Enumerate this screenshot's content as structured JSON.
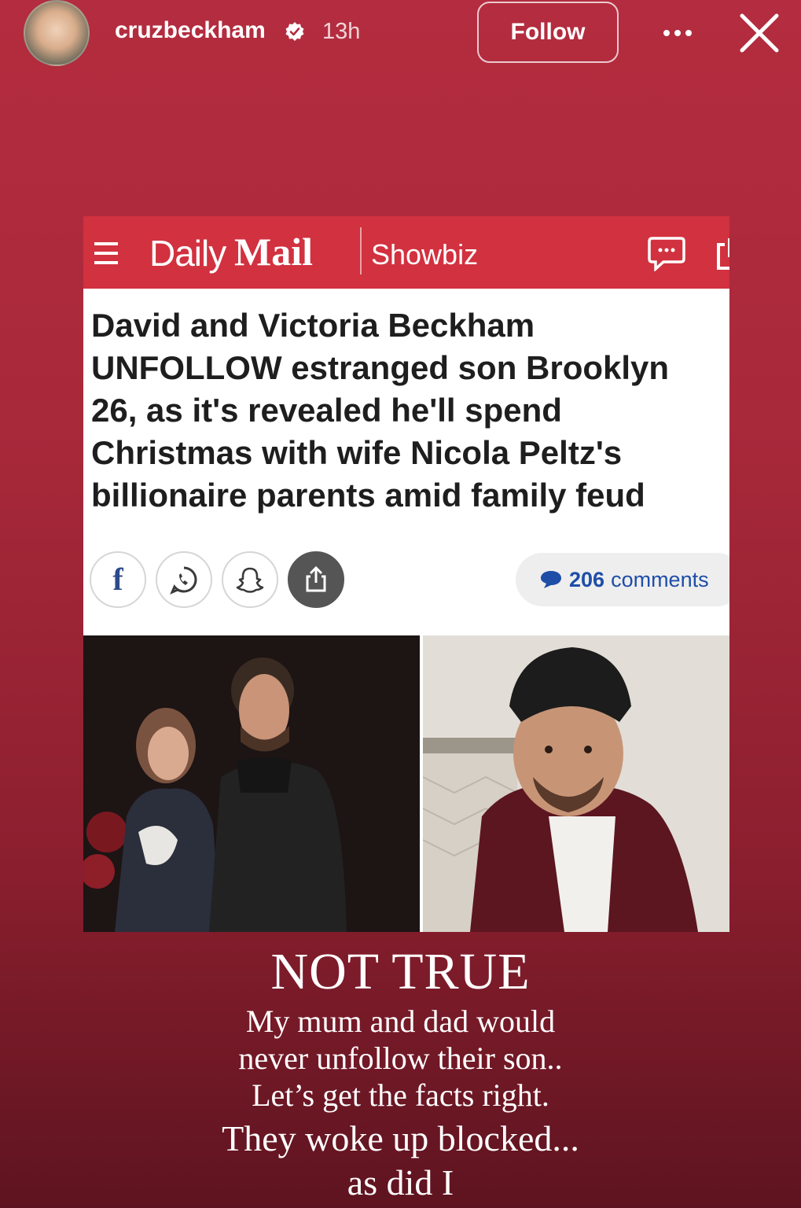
{
  "story": {
    "username": "cruzbeckham",
    "time_ago": "13h",
    "follow_label": "Follow",
    "more_icon": "more-dots-icon",
    "close_icon": "close-icon"
  },
  "article": {
    "brand_daily": "Daily",
    "brand_mail": "Mail",
    "section": "Showbiz",
    "headline_lines": [
      "David and Victoria Beckham",
      "UNFOLLOW estranged son Brooklyn",
      "26, as it's revealed he'll spend",
      "Christmas with wife Nicola Peltz's",
      "billionaire parents amid family feud"
    ],
    "comments_count": "206",
    "comments_word": "comments",
    "share_icons": [
      "facebook-icon",
      "whatsapp-icon",
      "snapchat-icon",
      "share-icon"
    ],
    "colors": {
      "brand_red": "#d2313f",
      "comments_blue": "#1e4ea8"
    }
  },
  "caption": {
    "heading": "NOT TRUE",
    "lines": [
      "My mum and dad would",
      "never unfollow their son..",
      "Let’s get the facts right."
    ],
    "closing_lines": [
      "They woke up blocked...",
      "as did I"
    ]
  }
}
